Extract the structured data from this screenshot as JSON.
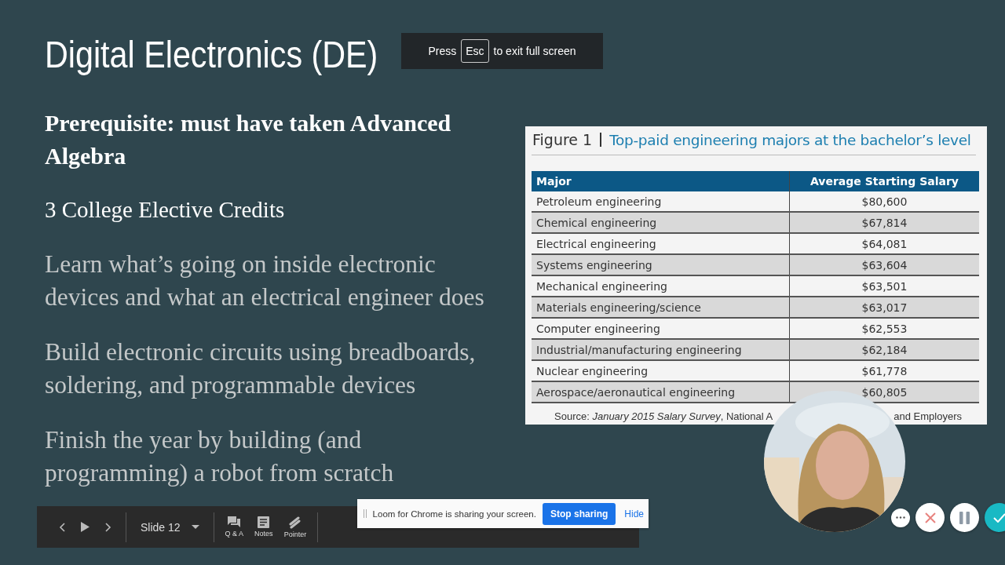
{
  "slide": {
    "title": "Digital Electronics (DE)",
    "prerequisite": "Prerequisite:  must have taken Advanced Algebra",
    "credits": "3 College Elective Credits",
    "points": [
      "Learn what’s going on inside electronic devices and what an electrical engineer does",
      "Build electronic circuits using breadboards, soldering, and programmable devices",
      "Finish the year by building (and programming) a robot from scratch"
    ]
  },
  "fullscreen_hint": {
    "before": "Press",
    "key": "Esc",
    "after": "to exit full screen"
  },
  "figure": {
    "label": "Figure 1",
    "title": "Top-paid engineering majors at the bachelor’s level",
    "columns": [
      "Major",
      "Average Starting Salary"
    ],
    "rows": [
      {
        "major": "Petroleum engineering",
        "salary": "$80,600"
      },
      {
        "major": "Chemical engineering",
        "salary": "$67,814"
      },
      {
        "major": "Electrical engineering",
        "salary": "$64,081"
      },
      {
        "major": "Systems engineering",
        "salary": "$63,604"
      },
      {
        "major": "Mechanical engineering",
        "salary": "$63,501"
      },
      {
        "major": "Materials engineering/science",
        "salary": "$63,017"
      },
      {
        "major": "Computer engineering",
        "salary": "$62,553"
      },
      {
        "major": "Industrial/manufacturing engineering",
        "salary": "$62,184"
      },
      {
        "major": "Nuclear engineering",
        "salary": "$61,778"
      },
      {
        "major": "Aerospace/aeronautical engineering",
        "salary": "$60,805"
      }
    ],
    "source": "Source: *January 2015 Salary Survey*, National A",
    "source_end": "and Employers"
  },
  "toolbar": {
    "slide_label": "Slide 12",
    "tools": [
      {
        "kind": "qa",
        "label": "Q & A"
      },
      {
        "kind": "notes",
        "label": "Notes"
      },
      {
        "kind": "pointer",
        "label": "Pointer"
      }
    ]
  },
  "share_bar": {
    "message": "Loom for Chrome is sharing your screen.",
    "stop_button": "Stop sharing",
    "hide_link": "Hide"
  }
}
